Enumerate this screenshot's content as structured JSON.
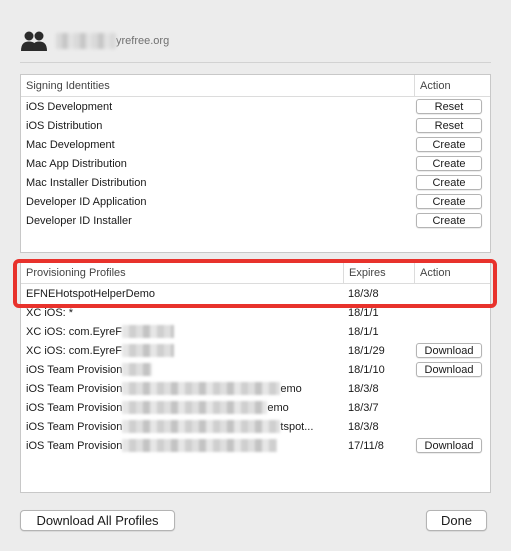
{
  "account": {
    "icon": "users-icon",
    "email_suffix": "yrefree.org"
  },
  "signing_identities": {
    "headers": {
      "name": "Signing Identities",
      "action": "Action"
    },
    "rows": [
      {
        "name": "iOS Development",
        "action": "Reset"
      },
      {
        "name": "iOS Distribution",
        "action": "Reset"
      },
      {
        "name": "Mac Development",
        "action": "Create"
      },
      {
        "name": "Mac App Distribution",
        "action": "Create"
      },
      {
        "name": "Mac Installer Distribution",
        "action": "Create"
      },
      {
        "name": "Developer ID Application",
        "action": "Create"
      },
      {
        "name": "Developer ID Installer",
        "action": "Create"
      }
    ]
  },
  "provisioning_profiles": {
    "headers": {
      "name": "Provisioning Profiles",
      "expires": "Expires",
      "action": "Action"
    },
    "rows": [
      {
        "name": "EFNEHotspotHelperDemo",
        "suffix": "",
        "expires": "18/3/8",
        "action": ""
      },
      {
        "name": "XC iOS: *",
        "suffix": "",
        "expires": "18/1/1",
        "action": ""
      },
      {
        "name": "XC iOS: com.EyreF",
        "suffix": "",
        "expires": "18/1/1",
        "action": ""
      },
      {
        "name": "XC iOS: com.EyreF",
        "suffix": "",
        "expires": "18/1/29",
        "action": "Download"
      },
      {
        "name": "iOS Team Provision",
        "suffix": "",
        "expires": "18/1/10",
        "action": "Download"
      },
      {
        "name": "iOS Team Provision",
        "suffix": "emo",
        "expires": "18/3/8",
        "action": ""
      },
      {
        "name": "iOS Team Provision",
        "suffix": "emo",
        "expires": "18/3/7",
        "action": ""
      },
      {
        "name": "iOS Team Provision",
        "suffix": "tspot...",
        "expires": "18/3/8",
        "action": ""
      },
      {
        "name": "iOS Team Provision",
        "suffix": "",
        "expires": "17/11/8",
        "action": "Download"
      }
    ]
  },
  "footer": {
    "download_all": "Download All Profiles",
    "done": "Done"
  },
  "colors": {
    "highlight": "#e8322c",
    "background": "#ececec"
  }
}
